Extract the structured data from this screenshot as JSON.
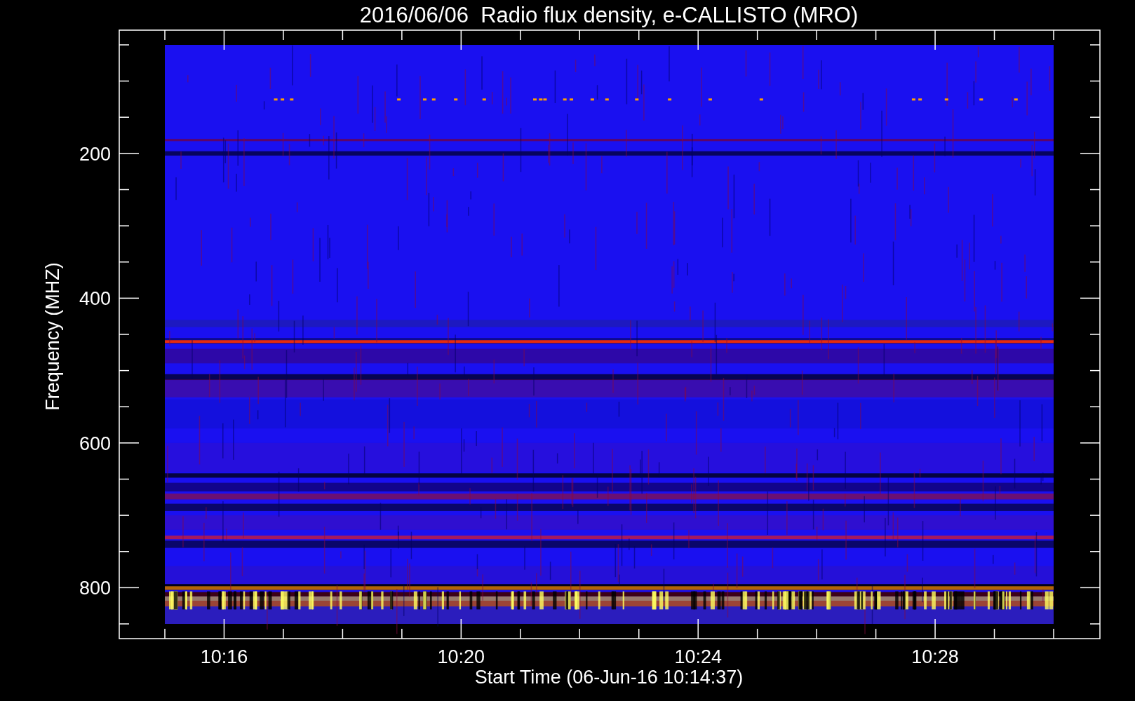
{
  "plot": {
    "title": "2016/06/06  Radio flux density, e-CALLISTO (MRO)",
    "y_axis": {
      "label": "Frequency (MHZ)",
      "ticks": [
        "200",
        "400",
        "600",
        "800"
      ]
    },
    "x_axis": {
      "label": "Start Time (06-Jun-16 10:14:37)",
      "ticks": [
        "10:16",
        "10:20",
        "10:24",
        "10:28"
      ]
    }
  }
}
